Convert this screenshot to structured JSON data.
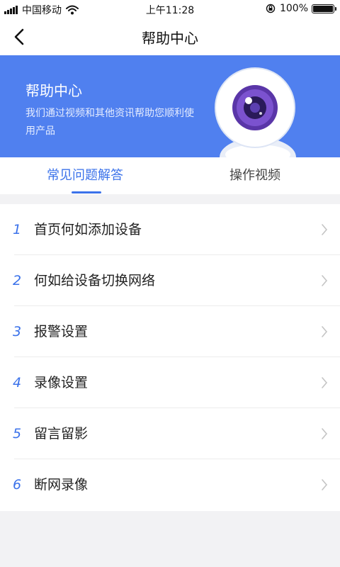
{
  "status_bar": {
    "carrier": "中国移动",
    "time": "上午11:28",
    "battery_pct": "100%",
    "battery_level": 1.0
  },
  "nav": {
    "title": "帮助中心",
    "back_icon": "chevron-left-icon"
  },
  "banner": {
    "title": "帮助中心",
    "description": "我们通过视频和其他资讯帮助您顺利使用产品",
    "background_color": "#5080ef",
    "illustration": "camera-eye-icon"
  },
  "tabs": [
    {
      "label": "常见问题解答",
      "active": true
    },
    {
      "label": "操作视频",
      "active": false
    }
  ],
  "accent_color": "#3b72ea",
  "faq": [
    {
      "num": "1",
      "label": "首页何如添加设备"
    },
    {
      "num": "2",
      "label": "何如给设备切换网络"
    },
    {
      "num": "3",
      "label": "报警设置"
    },
    {
      "num": "4",
      "label": "录像设置"
    },
    {
      "num": "5",
      "label": "留言留影"
    },
    {
      "num": "6",
      "label": "断网录像"
    }
  ]
}
